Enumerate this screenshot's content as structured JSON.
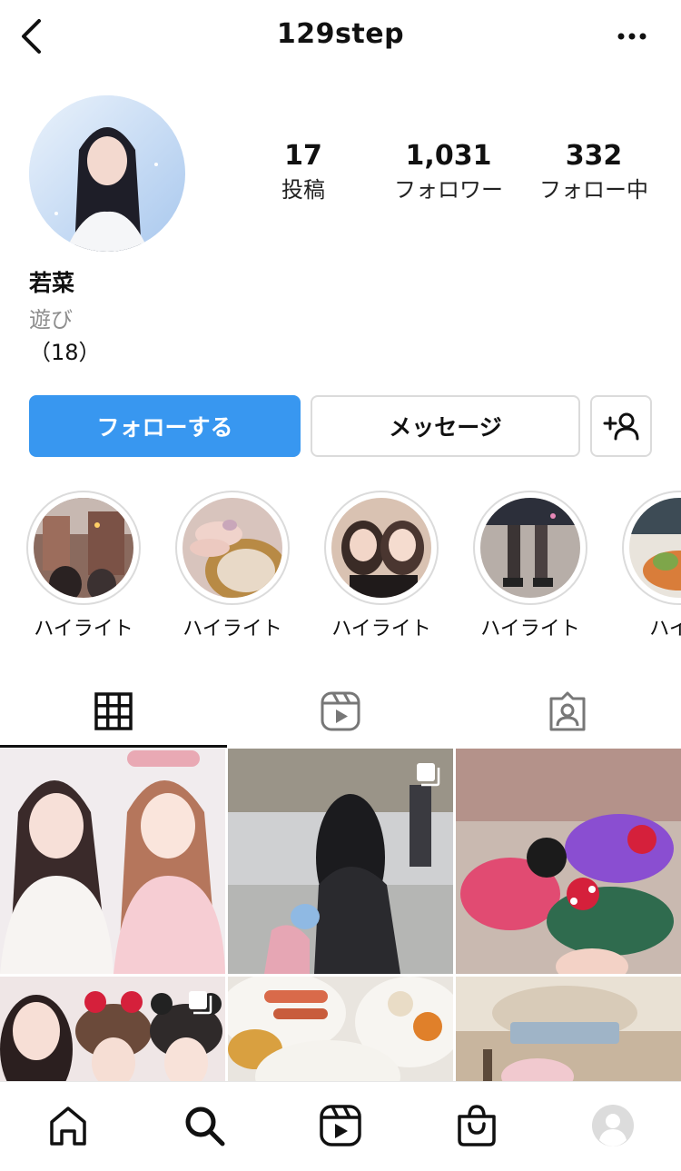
{
  "header": {
    "username": "129step"
  },
  "profile": {
    "name": "若菜",
    "category": "遊び",
    "bio": "（18）"
  },
  "stats": {
    "posts": {
      "count": "17",
      "label": "投稿"
    },
    "followers": {
      "count": "1,031",
      "label": "フォロワー"
    },
    "following": {
      "count": "332",
      "label": "フォロー中"
    }
  },
  "actions": {
    "follow_label": "フォローする",
    "message_label": "メッセージ"
  },
  "highlights": [
    {
      "label": "ハイライト"
    },
    {
      "label": "ハイライト"
    },
    {
      "label": "ハイライト"
    },
    {
      "label": "ハイライト"
    },
    {
      "label": "ハイラ"
    }
  ],
  "tabs": [
    {
      "icon": "grid-icon",
      "active": true
    },
    {
      "icon": "reels-icon",
      "active": false
    },
    {
      "icon": "tagged-icon",
      "active": false
    }
  ],
  "colors": {
    "accent": "#3897f0",
    "border": "#dbdbdb",
    "muted": "#8e8e8e"
  },
  "bottom_nav": [
    "home-icon",
    "search-icon",
    "reels-icon",
    "shop-icon",
    "profile-avatar"
  ]
}
